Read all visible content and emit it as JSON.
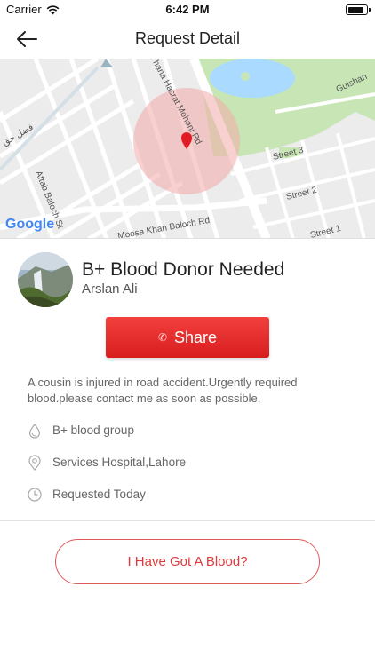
{
  "status_bar": {
    "carrier": "Carrier",
    "time": "6:42 PM"
  },
  "nav": {
    "title": "Request Detail",
    "back_icon": "back-arrow-icon"
  },
  "map": {
    "streets": [
      "hana Hasrat Mohani Rd",
      "Street 3",
      "Street 2",
      "Street 1",
      "Aftab Baloch St",
      "Moosa Khan Baloch Rd",
      "Gulshan",
      "فضل حق"
    ],
    "logo": "Google",
    "colors": {
      "land": "#ececec",
      "road": "#ffffff",
      "park": "#c8e6b5",
      "water": "#aadaff",
      "radius": "#f4aaaa",
      "pin": "#e31b23"
    }
  },
  "request": {
    "title": "B+ Blood Donor Needed",
    "requester": "Arslan Ali",
    "share_label": "Share",
    "description": "A cousin is injured in road accident.Urgently required blood.please contact me as soon as possible.",
    "details": [
      {
        "icon": "blood-drop-icon",
        "text": "B+ blood group"
      },
      {
        "icon": "location-pin-icon",
        "text": "Services Hospital,Lahore"
      },
      {
        "icon": "clock-icon",
        "text": "Requested Today"
      }
    ]
  },
  "actions": {
    "got_blood_label": "I Have Got A Blood?"
  },
  "colors": {
    "accent": "#e0393b",
    "share_button": "#e5262a"
  }
}
